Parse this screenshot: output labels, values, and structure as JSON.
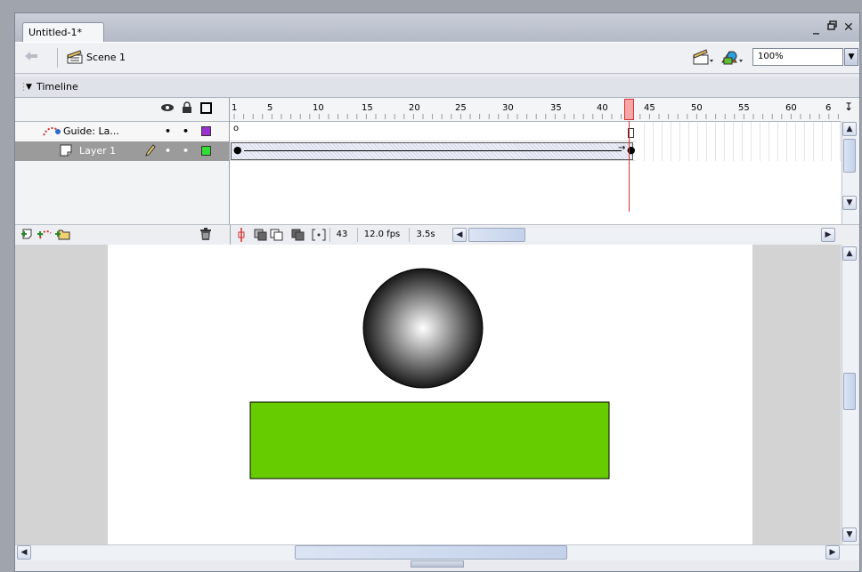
{
  "document": {
    "tab_title": "Untitled-1*",
    "minimize": "_",
    "restore": "Ɇ",
    "close": "✕"
  },
  "editbar": {
    "scene_label": "Scene 1",
    "zoom_value": "100%"
  },
  "timeline": {
    "header_label": "Timeline",
    "frame_numbers": [
      "1",
      "5",
      "10",
      "15",
      "20",
      "25",
      "30",
      "35",
      "40",
      "45",
      "50",
      "55",
      "60",
      "6"
    ],
    "layers": [
      {
        "name": "Guide: La...",
        "color": "#9b30d0",
        "type": "guide"
      },
      {
        "name": "Layer 1",
        "color": "#33dd33",
        "type": "normal",
        "selected": true
      }
    ],
    "current_frame": "43",
    "frame_rate": "12.0 fps",
    "elapsed_time": "3.5s",
    "playhead_color": "#d83030"
  },
  "stage": {
    "ball_gradient": [
      "#ffffff",
      "#000000"
    ],
    "rectangle_color": "#66cc00"
  },
  "icons": [
    "back-arrow-icon",
    "scene-icon",
    "edit-scene-icon",
    "edit-symbol-icon",
    "eye-icon",
    "lock-icon",
    "outline-icon",
    "guide-layer-icon",
    "layer-icon",
    "pencil-icon",
    "insert-layer-icon",
    "motion-guide-icon",
    "insert-folder-icon",
    "trash-icon",
    "center-frame-icon",
    "onion-skin-icon",
    "onion-outline-icon",
    "edit-multiple-icon",
    "onion-markers-icon",
    "timeline-menu-icon"
  ]
}
